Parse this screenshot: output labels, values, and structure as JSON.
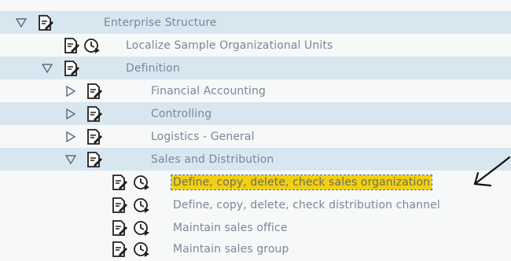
{
  "tree": {
    "nodes": [
      {
        "label": "Enterprise Structure",
        "expanded": true,
        "has_run_icon": false,
        "selected": false
      },
      {
        "label": "Localize Sample Organizational Units",
        "has_run_icon": true,
        "selected": false
      },
      {
        "label": "Definition",
        "expanded": true,
        "has_run_icon": false,
        "selected": false
      },
      {
        "label": "Financial Accounting",
        "expanded": false,
        "has_run_icon": false,
        "selected": false
      },
      {
        "label": "Controlling",
        "expanded": false,
        "has_run_icon": false,
        "selected": false
      },
      {
        "label": "Logistics - General",
        "expanded": false,
        "has_run_icon": false,
        "selected": false
      },
      {
        "label": "Sales and Distribution",
        "expanded": true,
        "has_run_icon": false,
        "selected": false
      },
      {
        "label": "Define, copy, delete, check sales organization",
        "has_run_icon": true,
        "selected": true
      },
      {
        "label": "Define, copy, delete, check distribution channel",
        "has_run_icon": true,
        "selected": false
      },
      {
        "label": "Maintain sales office",
        "has_run_icon": true,
        "selected": false
      },
      {
        "label": "Maintain sales group",
        "has_run_icon": true,
        "selected": false
      }
    ]
  },
  "colors": {
    "band": "#d8e6f0",
    "background": "#f7f8f8",
    "highlight": "#f2cf12",
    "text": "#7a8899"
  },
  "icons": {
    "expanded": "triangle-down-icon",
    "collapsed": "triangle-right-icon",
    "document": "document-pen-icon",
    "execute": "clock-execute-icon",
    "annotation": "hand-drawn-arrow-icon"
  }
}
